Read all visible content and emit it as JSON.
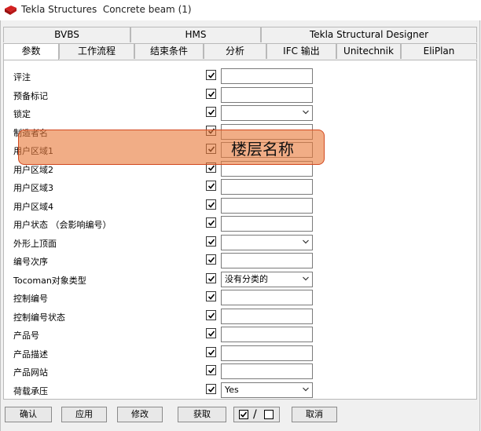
{
  "window": {
    "title": "Tekla Structures  Concrete beam (1)"
  },
  "tabs_top": [
    {
      "label": "BVBS"
    },
    {
      "label": "HMS"
    },
    {
      "label": "Tekla Structural Designer"
    }
  ],
  "tabs_bottom": [
    {
      "label": "参数",
      "active": true
    },
    {
      "label": "工作流程"
    },
    {
      "label": "结束条件"
    },
    {
      "label": "分析"
    },
    {
      "label": "IFC 输出"
    },
    {
      "label": "Unitechnik"
    },
    {
      "label": "EliPlan"
    }
  ],
  "rows": [
    {
      "label": "评注",
      "checked": true,
      "type": "text",
      "value": ""
    },
    {
      "label": "预备标记",
      "checked": true,
      "type": "text",
      "value": ""
    },
    {
      "label": "锁定",
      "checked": true,
      "type": "select",
      "value": ""
    },
    {
      "label": "制造者名",
      "checked": true,
      "type": "text",
      "value": ""
    },
    {
      "label": "用户区域1",
      "checked": true,
      "type": "text",
      "value": ""
    },
    {
      "label": "用户区域2",
      "checked": true,
      "type": "text",
      "value": ""
    },
    {
      "label": "用户区域3",
      "checked": true,
      "type": "text",
      "value": ""
    },
    {
      "label": "用户区域4",
      "checked": true,
      "type": "text",
      "value": ""
    },
    {
      "label": "用户状态  （会影响编号）",
      "checked": true,
      "type": "text",
      "value": ""
    },
    {
      "label": "外形上顶面",
      "checked": true,
      "type": "select",
      "value": ""
    },
    {
      "label": "编号次序",
      "checked": true,
      "type": "text",
      "value": ""
    },
    {
      "label": "Tocoman对象类型",
      "checked": true,
      "type": "select",
      "value": "没有分类的"
    },
    {
      "label": "控制编号",
      "checked": true,
      "type": "text",
      "value": ""
    },
    {
      "label": "控制编号状态",
      "checked": true,
      "type": "text",
      "value": ""
    },
    {
      "label": "产品号",
      "checked": true,
      "type": "text",
      "value": ""
    },
    {
      "label": "产品描述",
      "checked": true,
      "type": "text",
      "value": ""
    },
    {
      "label": "产品网站",
      "checked": true,
      "type": "text",
      "value": ""
    },
    {
      "label": "荷载承压",
      "checked": true,
      "type": "select",
      "value": "Yes"
    }
  ],
  "annotation": {
    "text": "楼层名称",
    "color": "#e87a3c"
  },
  "footer": {
    "ok": "确认",
    "apply": "应用",
    "modify": "修改",
    "get": "获取",
    "toggle_separator": "/",
    "cancel": "取消"
  }
}
